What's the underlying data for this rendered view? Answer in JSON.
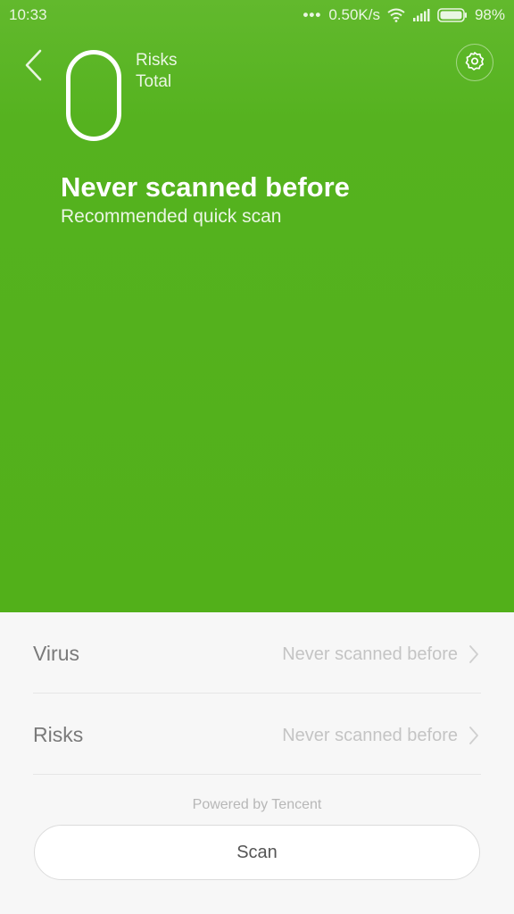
{
  "status_bar": {
    "time": "10:33",
    "network_speed": "0.50K/s",
    "battery": "98%",
    "icons": [
      "more-dots-icon",
      "wifi-icon",
      "signal-icon",
      "battery-icon"
    ]
  },
  "header": {
    "risk_count": "0",
    "risks_label": "Risks",
    "total_label": "Total",
    "title": "Never scanned before",
    "subtitle": "Recommended quick scan",
    "icons": [
      "back-icon",
      "gear-icon"
    ]
  },
  "list": {
    "items": [
      {
        "label": "Virus",
        "status": "Never scanned before"
      },
      {
        "label": "Risks",
        "status": "Never scanned before"
      }
    ]
  },
  "footer": {
    "powered_by": "Powered by Tencent",
    "scan_label": "Scan"
  },
  "colors": {
    "accent": "#55b21f",
    "background": "#f7f7f7"
  }
}
